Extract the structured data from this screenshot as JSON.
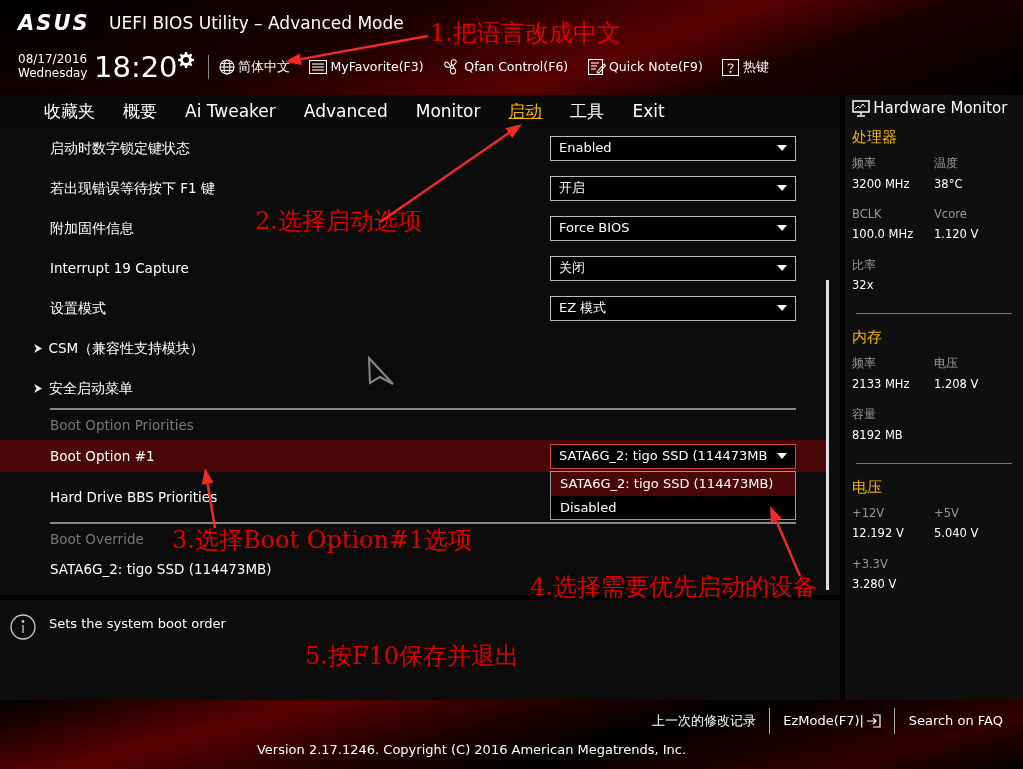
{
  "header": {
    "logo": "ASUS",
    "title": "UEFI BIOS Utility – Advanced Mode",
    "date": "08/17/2016",
    "weekday": "Wednesday",
    "time": "18:20",
    "toolbar": [
      {
        "label": "简体中文"
      },
      {
        "label": "MyFavorite(F3)"
      },
      {
        "label": "Qfan Control(F6)"
      },
      {
        "label": "Quick Note(F9)"
      },
      {
        "label": "热键"
      }
    ]
  },
  "tabs": [
    {
      "label": "收藏夹",
      "selected": false
    },
    {
      "label": "概要",
      "selected": false
    },
    {
      "label": "Ai Tweaker",
      "selected": false
    },
    {
      "label": "Advanced",
      "selected": false
    },
    {
      "label": "Monitor",
      "selected": false
    },
    {
      "label": "启动",
      "selected": true
    },
    {
      "label": "工具",
      "selected": false
    },
    {
      "label": "Exit",
      "selected": false
    }
  ],
  "settings": [
    {
      "kind": "dropdown",
      "label": "启动时数字锁定键状态",
      "value": "Enabled",
      "selected": false
    },
    {
      "kind": "dropdown",
      "label": "若出现错误等待按下 F1 键",
      "value": "开启",
      "selected": false
    },
    {
      "kind": "dropdown",
      "label": "附加固件信息",
      "value": "Force BIOS",
      "selected": false
    },
    {
      "kind": "dropdown",
      "label": "Interrupt 19 Capture",
      "value": "关闭",
      "selected": false
    },
    {
      "kind": "dropdown",
      "label": "设置模式",
      "value": "EZ 模式",
      "selected": false
    },
    {
      "kind": "submenu",
      "label": "CSM（兼容性支持模块）",
      "selected": false
    },
    {
      "kind": "submenu",
      "label": "安全启动菜单",
      "selected": false
    },
    {
      "kind": "section",
      "label": "Boot Option Priorities"
    },
    {
      "kind": "dropdown",
      "label": "Boot Option #1",
      "value": "SATA6G_2: tigo SSD  (114473MB",
      "selected": true,
      "expanded": true,
      "options": [
        {
          "label": "SATA6G_2: tigo SSD  (114473MB)",
          "selected": true
        },
        {
          "label": "Disabled",
          "selected": false
        }
      ]
    },
    {
      "kind": "item",
      "label": "Hard Drive BBS Priorities",
      "selected": false
    },
    {
      "kind": "section",
      "label": "Boot Override"
    },
    {
      "kind": "item",
      "label": "SATA6G_2: tigo SSD  (114473MB)",
      "selected": false
    }
  ],
  "help": "Sets the system boot order",
  "hardware_monitor": {
    "title": "Hardware Monitor",
    "groups": [
      {
        "title": "处理器",
        "items": [
          {
            "label": "频率",
            "value": "3200 MHz"
          },
          {
            "label": "温度",
            "value": "38°C"
          },
          {
            "label": "BCLK",
            "value": "100.0 MHz"
          },
          {
            "label": "Vcore",
            "value": "1.120 V"
          },
          {
            "label": "比率",
            "value": "32x"
          }
        ]
      },
      {
        "title": "内存",
        "items": [
          {
            "label": "频率",
            "value": "2133 MHz"
          },
          {
            "label": "电压",
            "value": "1.208 V"
          },
          {
            "label": "容量",
            "value": "8192 MB"
          }
        ]
      },
      {
        "title": "电压",
        "items": [
          {
            "label": "+12V",
            "value": "12.192 V"
          },
          {
            "label": "+5V",
            "value": "5.040 V"
          },
          {
            "label": "+3.3V",
            "value": "3.280 V"
          }
        ]
      }
    ]
  },
  "footer": {
    "links": [
      {
        "label": "上一次的修改记录"
      },
      {
        "label": "EzMode(F7)|"
      },
      {
        "label": "Search on FAQ"
      }
    ],
    "version": "Version 2.17.1246. Copyright (C) 2016 American Megatrends, Inc."
  },
  "annotations": [
    {
      "text": "1.把语言改成中文"
    },
    {
      "text": "2.选择启动选项"
    },
    {
      "text": "3.选择Boot Option#1选项"
    },
    {
      "text": "4.选择需要优先启动的设备"
    },
    {
      "text": "5.按F10保存并退出"
    }
  ]
}
